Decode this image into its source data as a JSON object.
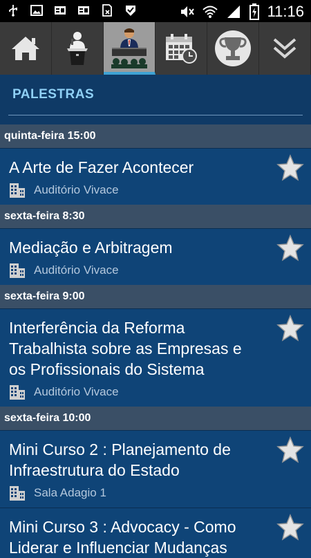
{
  "status_bar": {
    "time": "11:16",
    "left_icons": [
      "usb-icon",
      "image-icon",
      "id-card-icon",
      "id-card-icon",
      "sim-icon",
      "checkmark-icon"
    ],
    "right_icons": [
      "no-sound-icon",
      "wifi-icon",
      "signal-icon",
      "battery-icon"
    ]
  },
  "nav": {
    "items": [
      {
        "icon": "home-icon"
      },
      {
        "icon": "speaker-podium-icon"
      },
      {
        "icon": "conference-icon",
        "active": true
      },
      {
        "icon": "calendar-icon"
      },
      {
        "icon": "trophy-icon"
      },
      {
        "icon": "chevron-down-icon"
      }
    ]
  },
  "section": {
    "title": "PALESTRAS"
  },
  "days": [
    {
      "label": "quinta-feira 15:00",
      "events": [
        {
          "title": "A Arte de Fazer Acontecer",
          "room": "Auditório Vivace"
        }
      ]
    },
    {
      "label": "sexta-feira 8:30",
      "events": [
        {
          "title": "Mediação e Arbitragem",
          "room": "Auditório Vivace"
        }
      ]
    },
    {
      "label": "sexta-feira 9:00",
      "events": [
        {
          "title": "Interferência da Reforma Trabalhista sobre as Empresas e os Profissionais do Sistema",
          "room": "Auditório Vivace"
        }
      ]
    },
    {
      "label": "sexta-feira 10:00",
      "events": [
        {
          "title": "Mini Curso 2 : Planejamento de Infraestrutura do Estado",
          "room": "Sala Adagio 1"
        },
        {
          "title": "Mini Curso 3 : Advocacy - Como Liderar e Influenciar Mudanças",
          "room": ""
        }
      ]
    }
  ]
}
